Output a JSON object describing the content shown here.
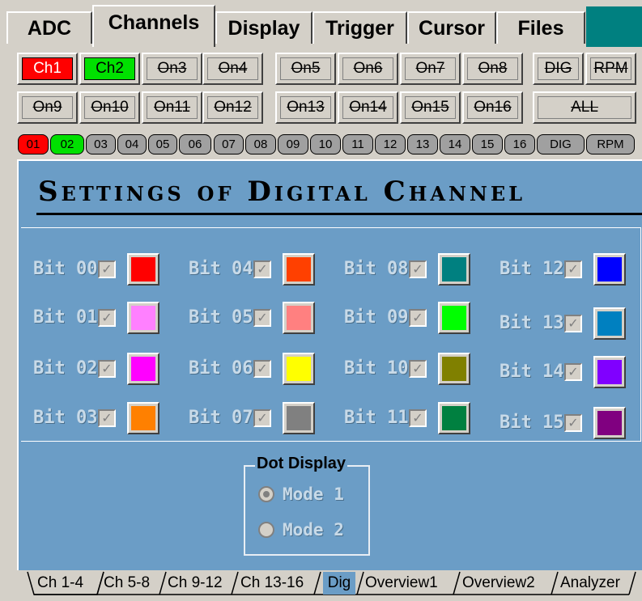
{
  "top_tabs": [
    "ADC",
    "Channels",
    "Display",
    "Trigger",
    "Cursor",
    "Files"
  ],
  "channel_buttons": {
    "row1": [
      "Ch1",
      "Ch2",
      "On3",
      "On4",
      "On5",
      "On6",
      "On7",
      "On8"
    ],
    "row2": [
      "On9",
      "On10",
      "On11",
      "On12",
      "On13",
      "On14",
      "On15",
      "On16"
    ],
    "dig": "DIG",
    "rpm": "RPM",
    "all": "ALL",
    "ch1_color": "#ff0000",
    "ch2_color": "#00e000"
  },
  "pills": [
    "01",
    "02",
    "03",
    "04",
    "05",
    "06",
    "07",
    "08",
    "09",
    "10",
    "11",
    "12",
    "13",
    "14",
    "15",
    "16",
    "DIG",
    "RPM"
  ],
  "panel": {
    "title": "Settings of Digital Channel",
    "checkmark": "✓",
    "bits": [
      {
        "label": "Bit 00",
        "color": "#ff0000"
      },
      {
        "label": "Bit 01",
        "color": "#ff80ff"
      },
      {
        "label": "Bit 02",
        "color": "#ff00ff"
      },
      {
        "label": "Bit 03",
        "color": "#ff8000"
      },
      {
        "label": "Bit 04",
        "color": "#ff4000"
      },
      {
        "label": "Bit 05",
        "color": "#ff8080"
      },
      {
        "label": "Bit 06",
        "color": "#ffff00"
      },
      {
        "label": "Bit 07",
        "color": "#808080"
      },
      {
        "label": "Bit 08",
        "color": "#008080"
      },
      {
        "label": "Bit 09",
        "color": "#00ff00"
      },
      {
        "label": "Bit 10",
        "color": "#808000"
      },
      {
        "label": "Bit 11",
        "color": "#008040"
      },
      {
        "label": "Bit 12",
        "color": "#0000ff"
      },
      {
        "label": "Bit 13",
        "color": "#0080c0"
      },
      {
        "label": "Bit 14",
        "color": "#8000ff"
      },
      {
        "label": "Bit 15",
        "color": "#800080"
      }
    ],
    "dot_display": {
      "legend": "Dot Display",
      "modes": [
        "Mode 1",
        "Mode 2"
      ],
      "selected": "Mode 1"
    }
  },
  "bottom_tabs": [
    "Ch 1-4",
    "Ch 5-8",
    "Ch 9-12",
    "Ch 13-16",
    "Dig",
    "Overview1",
    "Overview2",
    "Analyzer"
  ],
  "active_bottom_tab": "Dig"
}
